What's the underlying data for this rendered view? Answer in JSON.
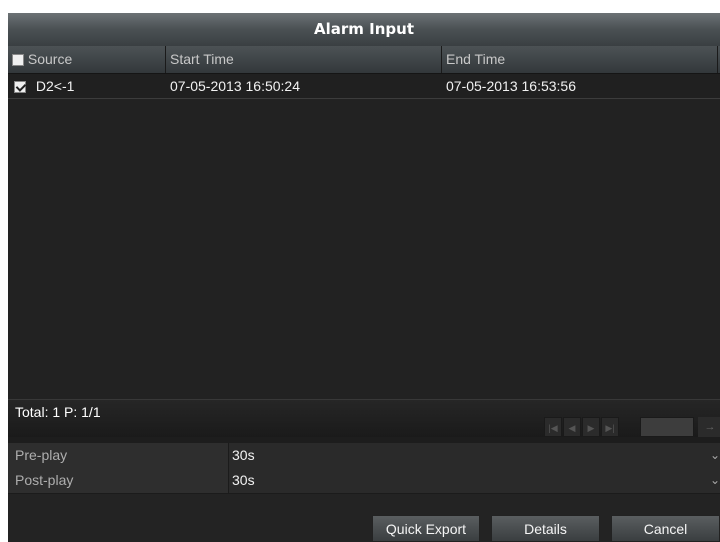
{
  "dialog": {
    "title": "Alarm Input"
  },
  "table": {
    "headers": {
      "source": "Source",
      "start": "Start Time",
      "end": "End Time"
    },
    "rows": [
      {
        "source": "D2<-1",
        "start": "07-05-2013 16:50:24",
        "end": "07-05-2013 16:53:56",
        "checked": true
      }
    ]
  },
  "footer": {
    "total": "Total: 1  P: 1/1",
    "pager_icons": [
      "first-page-icon",
      "prev-page-icon",
      "next-page-icon",
      "last-page-icon",
      "go-arrow-icon"
    ]
  },
  "settings": {
    "preplay": {
      "label": "Pre-play",
      "value": "30s"
    },
    "postplay": {
      "label": "Post-play",
      "value": "30s"
    }
  },
  "buttons": {
    "quick_export": "Quick Export",
    "details": "Details",
    "cancel": "Cancel"
  }
}
